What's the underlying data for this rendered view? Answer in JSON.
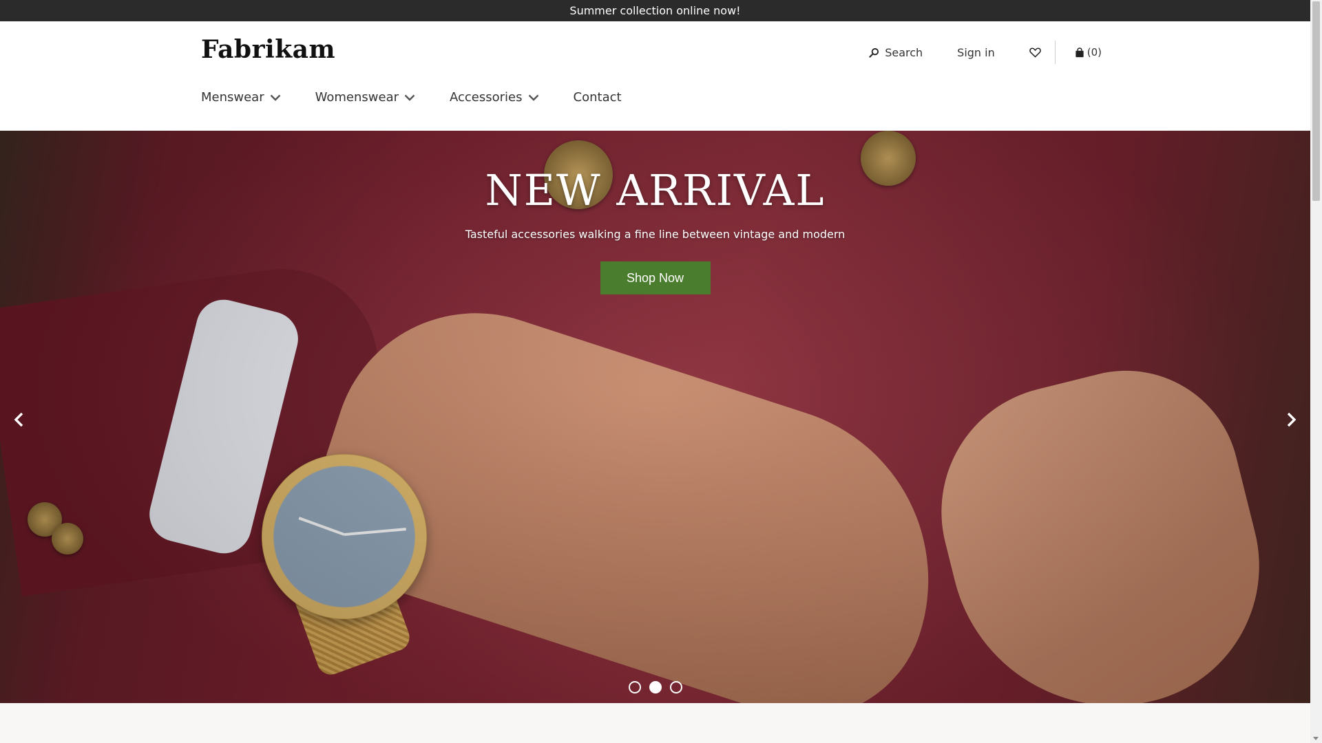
{
  "promo": {
    "text": "Summer collection online now!"
  },
  "header": {
    "logo": "Fabrikam",
    "search_label": "Search",
    "signin_label": "Sign in",
    "cart_count": "(0)"
  },
  "nav": {
    "items": [
      {
        "label": "Menswear"
      },
      {
        "label": "Womenswear"
      },
      {
        "label": "Accessories"
      },
      {
        "label": "Contact"
      }
    ]
  },
  "hero": {
    "title": "NEW ARRIVAL",
    "subtitle": "Tasteful accessories walking a fine line between vintage and modern",
    "cta_label": "Shop Now",
    "slide_count": 3,
    "active_slide": 2
  },
  "colors": {
    "promo_bg": "#2b2b2b",
    "cta_bg": "#4b7d2f",
    "hero_bg": "#7c2230"
  },
  "icons": {
    "search": "search-icon",
    "wishlist": "heart-icon",
    "cart": "shopping-bag-icon",
    "nav_dropdown": "chevron-down-icon",
    "prev": "chevron-left-icon",
    "next": "chevron-right-icon"
  }
}
